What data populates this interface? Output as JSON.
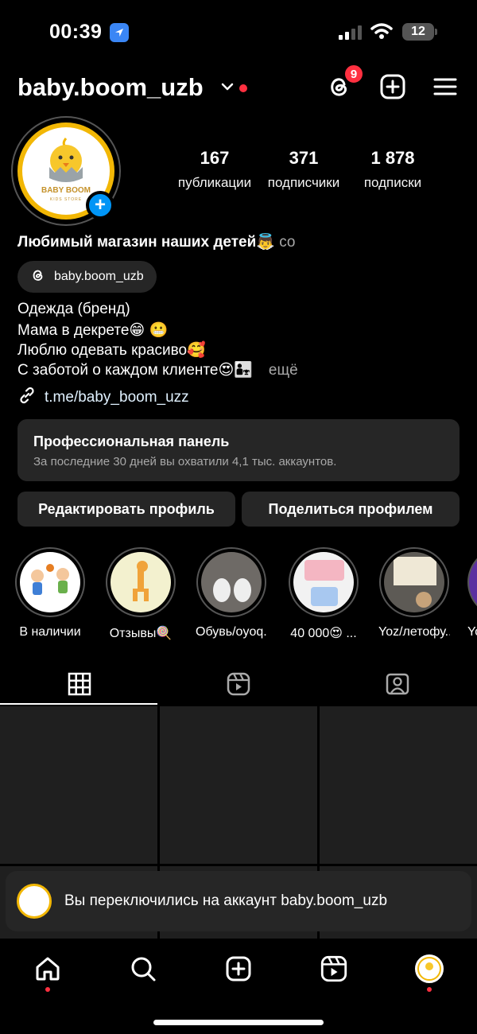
{
  "status_bar": {
    "time": "00:39",
    "battery": "12"
  },
  "header": {
    "username": "baby.boom_uzb",
    "threads_badge": "9"
  },
  "avatar": {
    "brand": "BABY BOOM",
    "tagline": "KIDS STORE"
  },
  "stats": [
    {
      "value": "167",
      "label": "публикации"
    },
    {
      "value": "371",
      "label": "подписчики"
    },
    {
      "value": "1 878",
      "label": "подписки"
    }
  ],
  "bio": {
    "name": "Любимый магазин наших детей👼",
    "name_more": " со",
    "threads_handle": "baby.boom_uzb",
    "lines": [
      "Одежда (бренд)",
      "Мама в декрете😁 😬",
      "Люблю одевать красиво🥰",
      "С заботой о каждом клиенте😍👨‍👧"
    ],
    "more": "ещё",
    "link": "t.me/baby_boom_uzz"
  },
  "pro_panel": {
    "title": "Профессиональная панель",
    "subtitle": "За последние 30 дней вы охватили 4,1 тыс. аккаунтов."
  },
  "buttons": {
    "edit": "Редактировать профиль",
    "share": "Поделиться профилем"
  },
  "highlights": [
    {
      "label": "В наличии"
    },
    {
      "label": "Отзывы🍭"
    },
    {
      "label": "Обувь/oyoq..."
    },
    {
      "label": "40 000😍 ..."
    },
    {
      "label": "Yoz/летофу..."
    },
    {
      "label": "Yo"
    }
  ],
  "toast": {
    "text": "Вы переключились на аккаунт baby.boom_uzb"
  },
  "icons": {
    "location": "location-arrow-icon",
    "threads": "threads-icon",
    "create": "plus-square-icon",
    "menu": "hamburger-menu-icon",
    "grid": "grid-icon",
    "reels": "reels-icon",
    "tagged": "tagged-icon",
    "home": "home-icon",
    "search": "search-icon",
    "link": "link-icon"
  },
  "colors": {
    "accent": "#0095f6",
    "notification": "#ff3040",
    "surface": "#262626",
    "brand_yellow": "#f2b705"
  }
}
